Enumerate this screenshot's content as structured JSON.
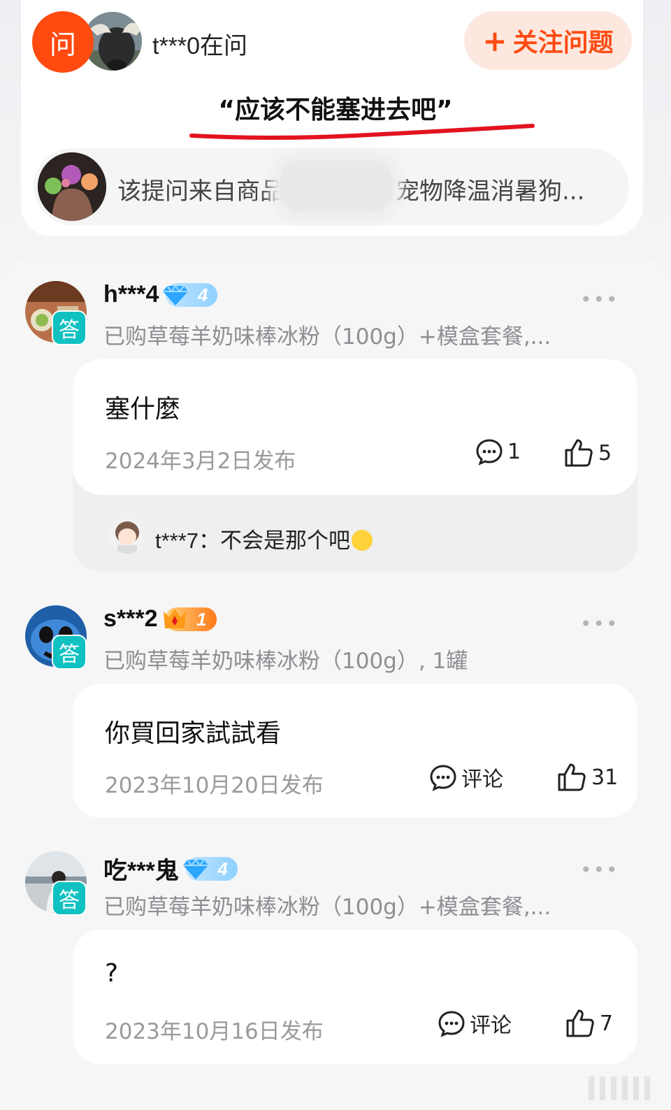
{
  "question": {
    "ask_badge": "问",
    "asker": "t***0在问",
    "follow_label": "关注问题",
    "follow_icon": "plus-icon",
    "title": "“应该不能塞进去吧”",
    "product_text_start": "该提问来自商品",
    "product_text_end": "宠物降温消暑狗..."
  },
  "answers": [
    {
      "tag": "答",
      "user": "h***4",
      "level": "4",
      "level_style": "diamond-blue",
      "purchase": "已购草莓羊奶味棒冰粉（100g）+模盒套餐,...",
      "text": "塞什麼",
      "date": "2024年3月2日发布",
      "comment": "1",
      "likes": "5",
      "reply": {
        "user": "t***7",
        "text": "：不会是那个吧"
      }
    },
    {
      "tag": "答",
      "user": "s***2",
      "level": "1",
      "level_style": "crown-gold",
      "purchase": "已购草莓羊奶味棒冰粉（100g）, 1罐",
      "text": "你買回家試試看",
      "date": "2023年10月20日发布",
      "comment": "评论",
      "likes": "31"
    },
    {
      "tag": "答",
      "user": "吃***鬼",
      "level": "4",
      "level_style": "diamond-blue",
      "purchase": "已购草莓羊奶味棒冰粉（100g）+模盒套餐,...",
      "text": "?",
      "date": "2023年10月16日发布",
      "comment": "评论",
      "likes": "7"
    }
  ],
  "colors": {
    "accent": "#ff4a10",
    "answer_tag": "#10c1c1",
    "underline_annotation": "#e3121f"
  }
}
